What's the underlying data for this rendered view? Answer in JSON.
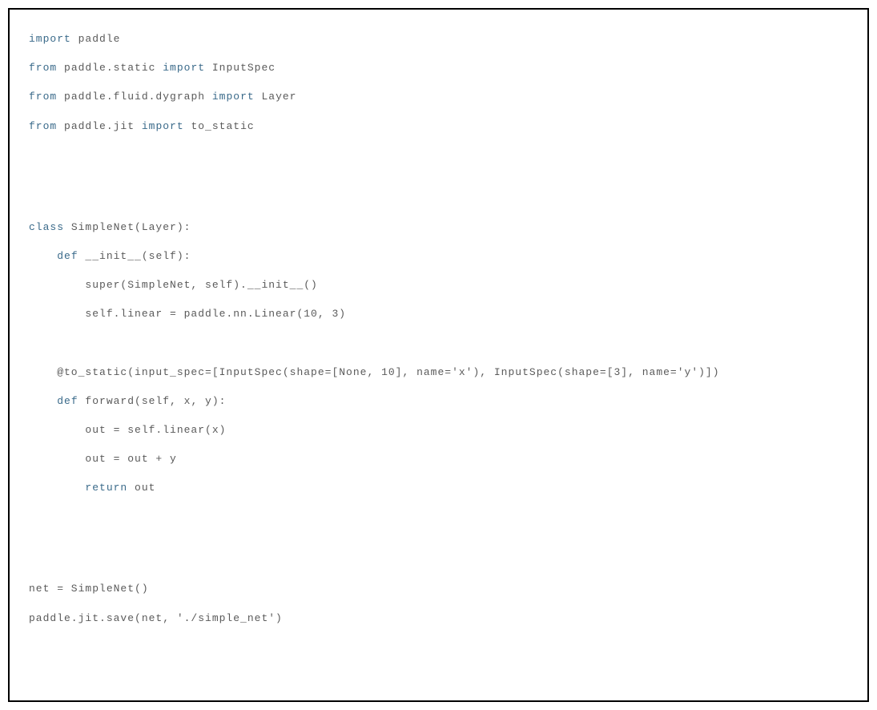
{
  "code": {
    "lines": [
      {
        "type": "line",
        "parts": [
          {
            "cls": "kw-import",
            "txt": "import"
          },
          {
            "cls": "",
            "txt": " paddle"
          }
        ]
      },
      {
        "type": "blank"
      },
      {
        "type": "line",
        "parts": [
          {
            "cls": "kw-import",
            "txt": "from"
          },
          {
            "cls": "",
            "txt": " paddle.static "
          },
          {
            "cls": "kw-import",
            "txt": "import"
          },
          {
            "cls": "",
            "txt": " InputSpec"
          }
        ]
      },
      {
        "type": "blank"
      },
      {
        "type": "line",
        "parts": [
          {
            "cls": "kw-import",
            "txt": "from"
          },
          {
            "cls": "",
            "txt": " paddle.fluid.dygraph "
          },
          {
            "cls": "kw-import",
            "txt": "import"
          },
          {
            "cls": "",
            "txt": " Layer"
          }
        ]
      },
      {
        "type": "blank"
      },
      {
        "type": "line",
        "parts": [
          {
            "cls": "kw-import",
            "txt": "from"
          },
          {
            "cls": "",
            "txt": " paddle.jit "
          },
          {
            "cls": "kw-import",
            "txt": "import"
          },
          {
            "cls": "",
            "txt": " to_static"
          }
        ]
      },
      {
        "type": "blank"
      },
      {
        "type": "blank"
      },
      {
        "type": "blank"
      },
      {
        "type": "blank"
      },
      {
        "type": "blank"
      },
      {
        "type": "blank"
      },
      {
        "type": "line",
        "parts": [
          {
            "cls": "kw-class",
            "txt": "class"
          },
          {
            "cls": "",
            "txt": " SimpleNet(Layer):"
          }
        ]
      },
      {
        "type": "blank"
      },
      {
        "type": "line",
        "parts": [
          {
            "cls": "",
            "txt": "    "
          },
          {
            "cls": "kw-def",
            "txt": "def"
          },
          {
            "cls": "",
            "txt": " __init__(self):"
          }
        ]
      },
      {
        "type": "blank"
      },
      {
        "type": "line",
        "parts": [
          {
            "cls": "",
            "txt": "        super(SimpleNet, self).__init__()"
          }
        ]
      },
      {
        "type": "blank"
      },
      {
        "type": "line",
        "parts": [
          {
            "cls": "",
            "txt": "        self.linear = paddle.nn.Linear(10, 3)"
          }
        ]
      },
      {
        "type": "blank"
      },
      {
        "type": "blank"
      },
      {
        "type": "blank"
      },
      {
        "type": "line",
        "parts": [
          {
            "cls": "",
            "txt": "    @to_static(input_spec=[InputSpec(shape=[None, 10], name='x'), InputSpec(shape=[3], name='y')])"
          }
        ]
      },
      {
        "type": "blank"
      },
      {
        "type": "line",
        "parts": [
          {
            "cls": "",
            "txt": "    "
          },
          {
            "cls": "kw-def",
            "txt": "def"
          },
          {
            "cls": "",
            "txt": " forward(self, x, y):"
          }
        ]
      },
      {
        "type": "blank"
      },
      {
        "type": "line",
        "parts": [
          {
            "cls": "",
            "txt": "        out = self.linear(x)"
          }
        ]
      },
      {
        "type": "blank"
      },
      {
        "type": "line",
        "parts": [
          {
            "cls": "",
            "txt": "        out = out + y"
          }
        ]
      },
      {
        "type": "blank"
      },
      {
        "type": "line",
        "parts": [
          {
            "cls": "",
            "txt": "        "
          },
          {
            "cls": "kw-return",
            "txt": "return"
          },
          {
            "cls": "",
            "txt": " out"
          }
        ]
      },
      {
        "type": "blank"
      },
      {
        "type": "blank"
      },
      {
        "type": "blank"
      },
      {
        "type": "blank"
      },
      {
        "type": "blank"
      },
      {
        "type": "blank"
      },
      {
        "type": "line",
        "parts": [
          {
            "cls": "",
            "txt": "net = SimpleNet()"
          }
        ]
      },
      {
        "type": "blank"
      },
      {
        "type": "line",
        "parts": [
          {
            "cls": "",
            "txt": "paddle.jit.save(net, './simple_net')"
          }
        ]
      }
    ]
  }
}
